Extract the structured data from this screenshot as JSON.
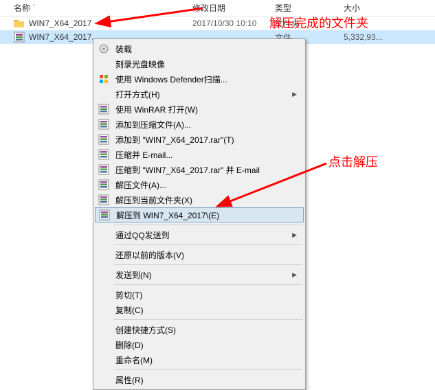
{
  "headers": {
    "name": "名称",
    "date": "修改日期",
    "type": "类型",
    "size": "大小"
  },
  "files": [
    {
      "name": "WIN7_X64_2017",
      "date": "2017/10/30 10:10",
      "type": "文件夹",
      "size": "",
      "icon": "folder",
      "selected": false
    },
    {
      "name": "WIN7_X64_2017....",
      "date": "",
      "type": "文件",
      "size": "5,332,93...",
      "icon": "rar",
      "selected": true
    }
  ],
  "menu": [
    {
      "label": "装载",
      "icon": "disc",
      "arrow": false
    },
    {
      "label": "刻录光盘映像",
      "icon": "none",
      "arrow": false
    },
    {
      "label": "使用 Windows Defender扫描...",
      "icon": "defender",
      "arrow": false
    },
    {
      "label": "打开方式(H)",
      "icon": "none",
      "arrow": true
    },
    {
      "label": "使用 WinRAR 打开(W)",
      "icon": "winrar",
      "arrow": false
    },
    {
      "label": "添加到压缩文件(A)...",
      "icon": "winrar",
      "arrow": false
    },
    {
      "label": "添加到 \"WIN7_X64_2017.rar\"(T)",
      "icon": "winrar",
      "arrow": false
    },
    {
      "label": "压缩并 E-mail...",
      "icon": "winrar",
      "arrow": false
    },
    {
      "label": "压缩到 \"WIN7_X64_2017.rar\" 并 E-mail",
      "icon": "winrar",
      "arrow": false
    },
    {
      "label": "解压文件(A)...",
      "icon": "winrar",
      "arrow": false
    },
    {
      "label": "解压到当前文件夹(X)",
      "icon": "winrar",
      "arrow": false
    },
    {
      "label": "解压到 WIN7_X64_2017\\(E)",
      "icon": "winrar",
      "arrow": false,
      "highlight": true
    },
    {
      "separator": true
    },
    {
      "label": "通过QQ发送到",
      "icon": "none",
      "arrow": true
    },
    {
      "separator": true
    },
    {
      "label": "还原以前的版本(V)",
      "icon": "none",
      "arrow": false
    },
    {
      "separator": true
    },
    {
      "label": "发送到(N)",
      "icon": "none",
      "arrow": true
    },
    {
      "separator": true
    },
    {
      "label": "剪切(T)",
      "icon": "none",
      "arrow": false
    },
    {
      "label": "复制(C)",
      "icon": "none",
      "arrow": false
    },
    {
      "separator": true
    },
    {
      "label": "创建快捷方式(S)",
      "icon": "none",
      "arrow": false
    },
    {
      "label": "删除(D)",
      "icon": "none",
      "arrow": false
    },
    {
      "label": "重命名(M)",
      "icon": "none",
      "arrow": false
    },
    {
      "separator": true
    },
    {
      "label": "属性(R)",
      "icon": "none",
      "arrow": false
    }
  ],
  "annotations": {
    "anno1": "解压完成的文件夹",
    "anno2": "点击解压"
  }
}
